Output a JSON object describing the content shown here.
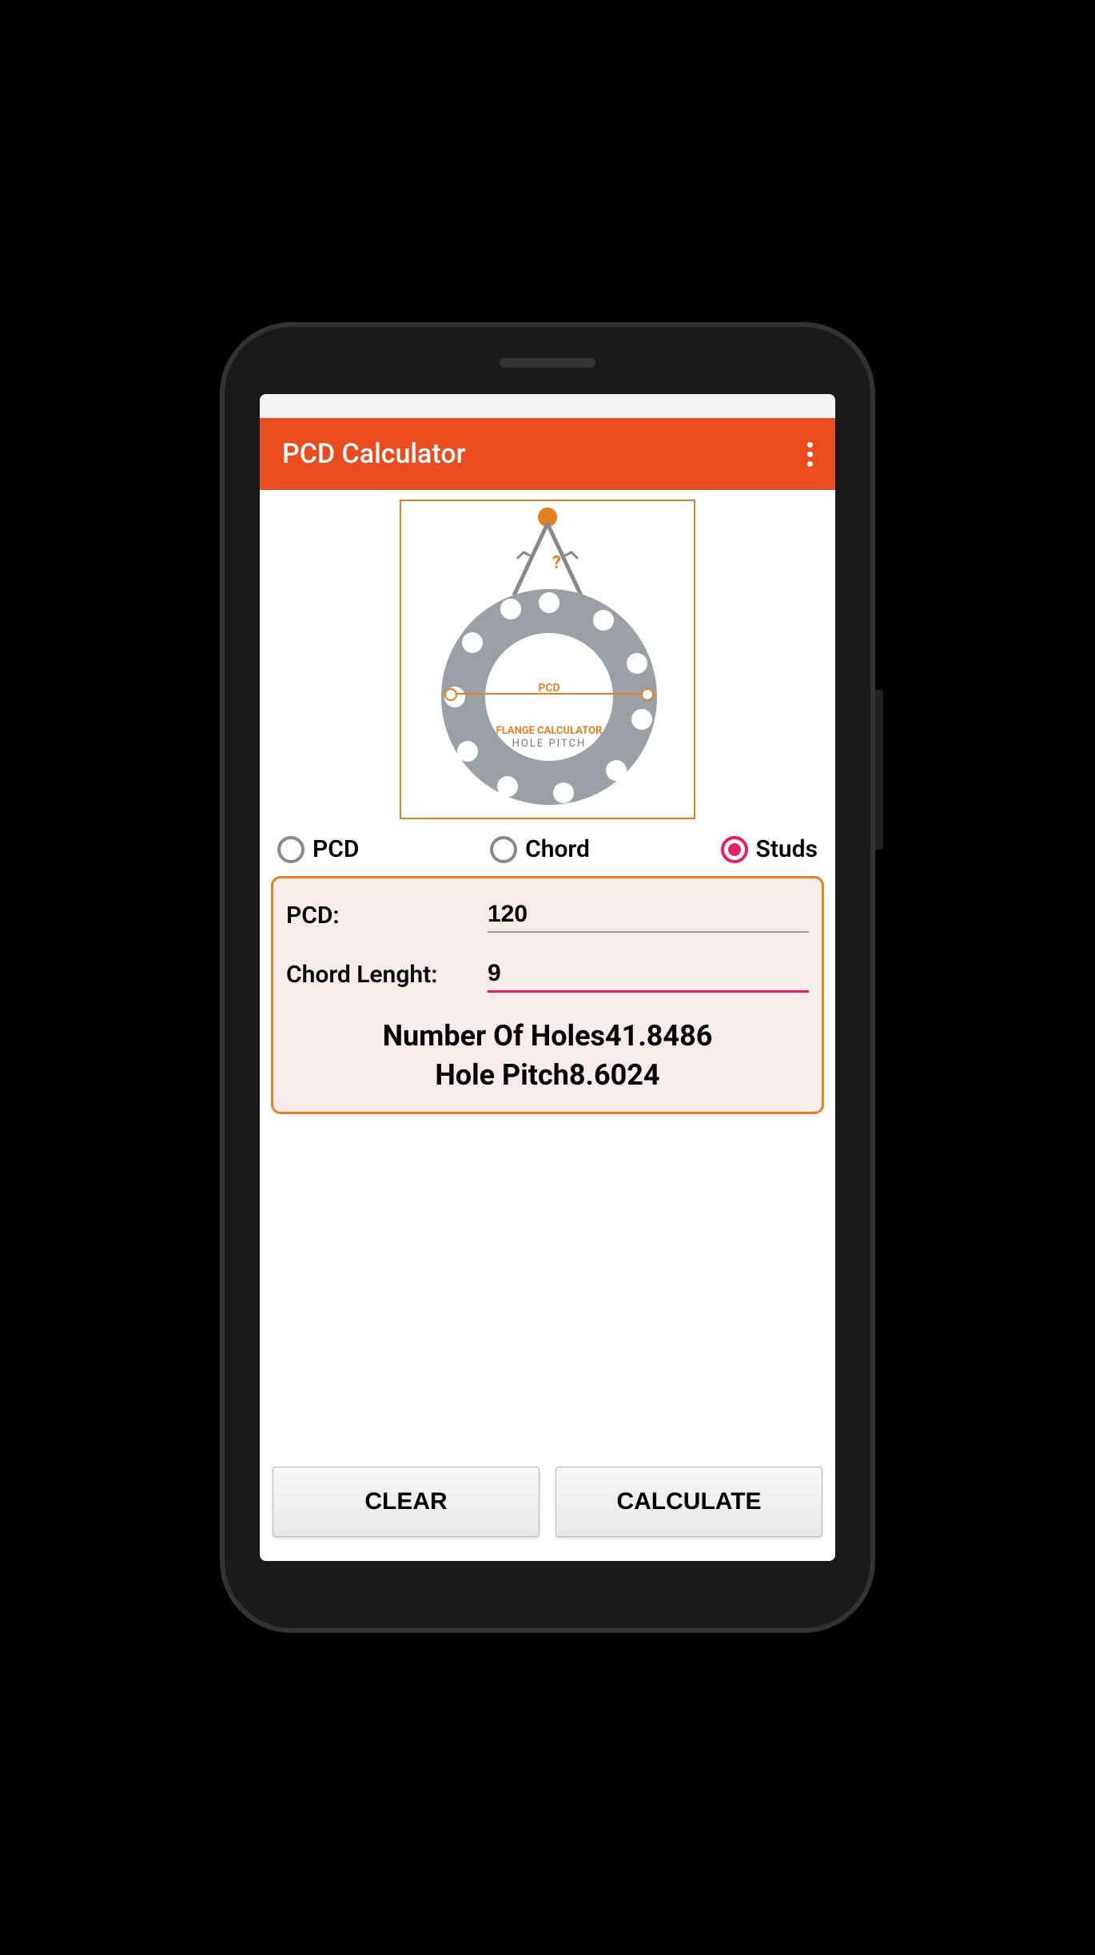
{
  "app": {
    "title": "PCD Calculator"
  },
  "diagram": {
    "pcd_label": "PCD",
    "line1": "FLANGE CALCULATOR",
    "line2": "HOLE  PITCH",
    "question": "?"
  },
  "radios": {
    "pcd": "PCD",
    "chord": "Chord",
    "studs": "Studs",
    "selected": "studs"
  },
  "inputs": {
    "pcd_label": "PCD:",
    "pcd_value": "120",
    "chord_label": "Chord Lenght:",
    "chord_value": "9"
  },
  "results": {
    "holes_label": "Number Of Holes",
    "holes_value": "41.8486",
    "pitch_label": "Hole Pitch",
    "pitch_value": "8.6024"
  },
  "buttons": {
    "clear": "CLEAR",
    "calculate": "CALCULATE"
  }
}
